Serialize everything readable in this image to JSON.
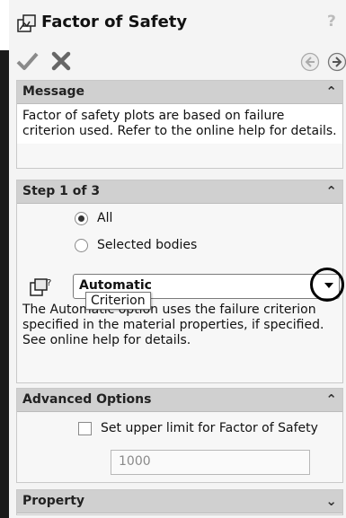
{
  "title": "Factor of Safety",
  "help_label": "?",
  "message": {
    "header": "Message",
    "text": "Factor of safety plots are based on failure criterion used. Refer to the online help for details."
  },
  "step": {
    "header": "Step 1 of 3",
    "radio_all": "All",
    "radio_selected": "Selected bodies",
    "combo_value": "Automatic",
    "tooltip": "Criterion",
    "description": "The Automatic option uses the failure criterion specified in the material properties, if specified. See online help for details."
  },
  "advanced": {
    "header": "Advanced Options",
    "checkbox_label": "Set upper limit for Factor of Safety",
    "limit_value": "1000"
  },
  "property": {
    "header": "Property"
  },
  "icons": {
    "collapse": "double-chevron-up-icon",
    "expand": "double-chevron-down-icon",
    "ok": "checkmark-icon",
    "cancel": "x-icon"
  },
  "colors": {
    "header_bg": "#d0d0d0",
    "panel_bg": "#f4f4f4",
    "ok_grey": "#8a8a8a"
  }
}
